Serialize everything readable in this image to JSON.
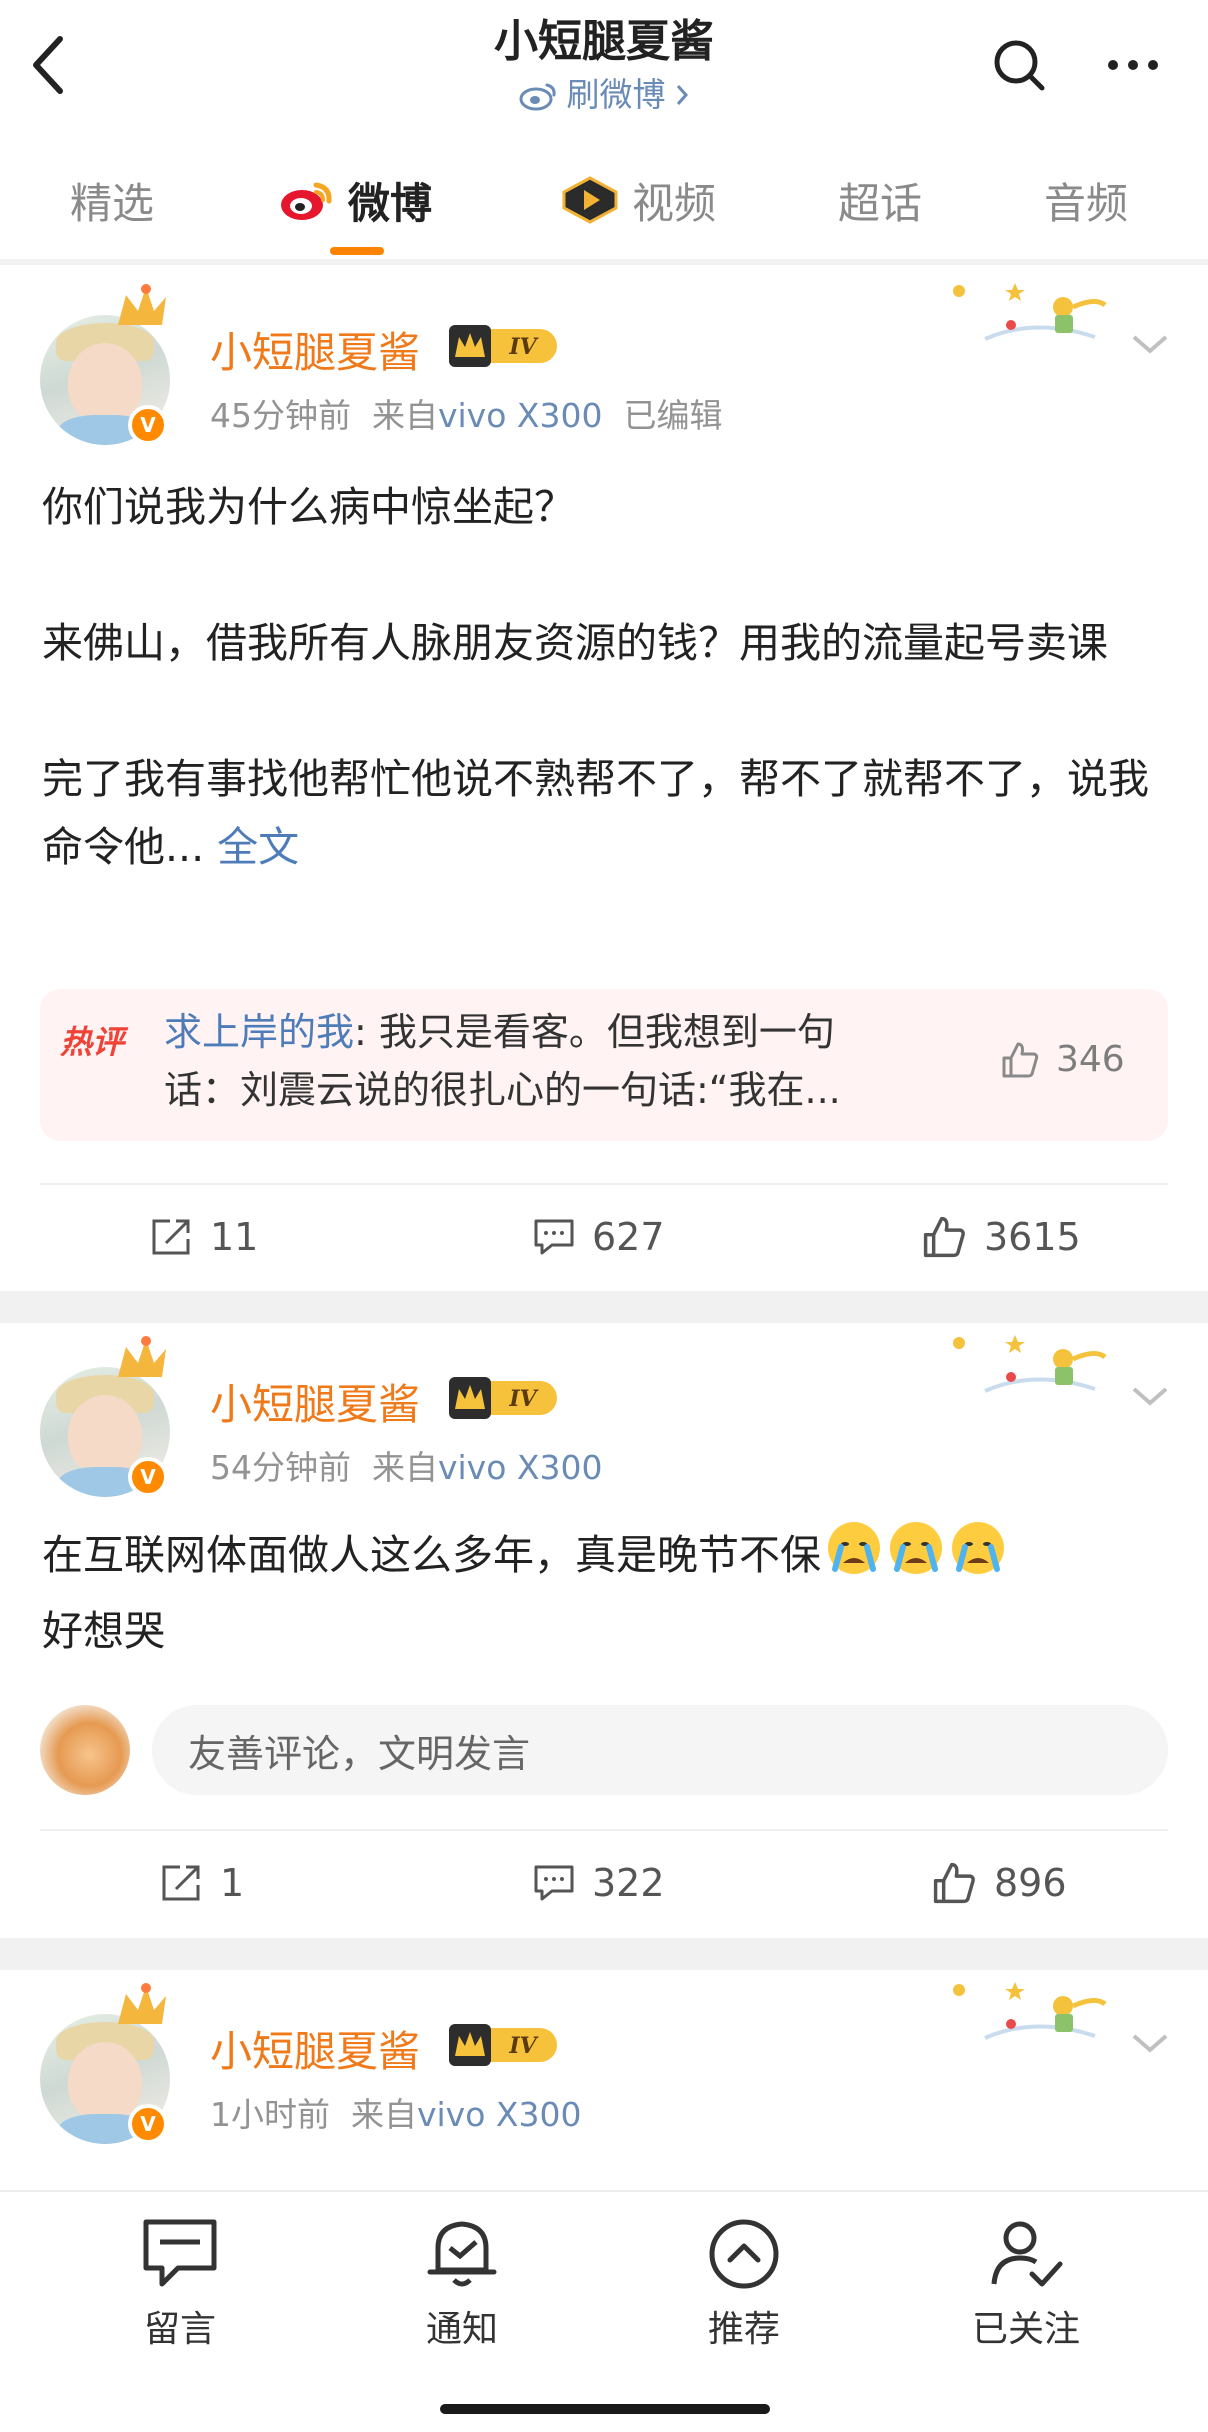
{
  "header": {
    "title": "小短腿夏酱",
    "subtitle": "刷微博",
    "back_icon": "back-arrow-icon",
    "search_icon": "search-icon",
    "more_icon": "more-icon"
  },
  "tabs": [
    {
      "label": "精选",
      "active": false
    },
    {
      "label": "微博",
      "active": true
    },
    {
      "label": "视频",
      "active": false
    },
    {
      "label": "超话",
      "active": false
    },
    {
      "label": "音频",
      "active": false
    }
  ],
  "colors": {
    "accent": "#ff8200",
    "username": "#f07a1a",
    "link": "#4e7cb9",
    "hot": "#ee4437"
  },
  "posts": [
    {
      "username": "小短腿夏酱",
      "level": "IV",
      "verified": "V",
      "time": "45分钟前",
      "source_prefix": "来自",
      "source": "vivo X300",
      "edited": "已编辑",
      "paragraphs": [
        "你们说我为什么病中惊坐起？",
        "来佛山，借我所有人脉朋友资源的钱？用我的流量起号卖课",
        "完了我有事找他帮忙他说不熟帮不了，帮不了就帮不了，说我命令他..."
      ],
      "full_text_link": "全文",
      "hot_comment": {
        "tag": "热评",
        "user": "求上岸的我",
        "line1": ": 我只是看客。但我想到一句",
        "line2": "话：刘震云说的很扎心的一句话:“我在...",
        "likes": "346"
      },
      "reposts": "11",
      "comments": "627",
      "likes": "3615"
    },
    {
      "username": "小短腿夏酱",
      "level": "IV",
      "verified": "V",
      "time": "54分钟前",
      "source_prefix": "来自",
      "source": "vivo X300",
      "line1": "在互联网体面做人这么多年，真是晚节不保",
      "line2": "好想哭",
      "emoji": "crying-face-icon",
      "comment_placeholder": "友善评论，文明发言",
      "reposts": "1",
      "comments": "322",
      "likes": "896"
    },
    {
      "username": "小短腿夏酱",
      "level": "IV",
      "verified": "V",
      "time": "1小时前",
      "source_prefix": "来自",
      "source": "vivo X300"
    }
  ],
  "bottom_bar": [
    {
      "label": "留言",
      "icon": "message-icon"
    },
    {
      "label": "通知",
      "icon": "bell-icon"
    },
    {
      "label": "推荐",
      "icon": "recommend-icon"
    },
    {
      "label": "已关注",
      "icon": "followed-user-icon"
    }
  ]
}
